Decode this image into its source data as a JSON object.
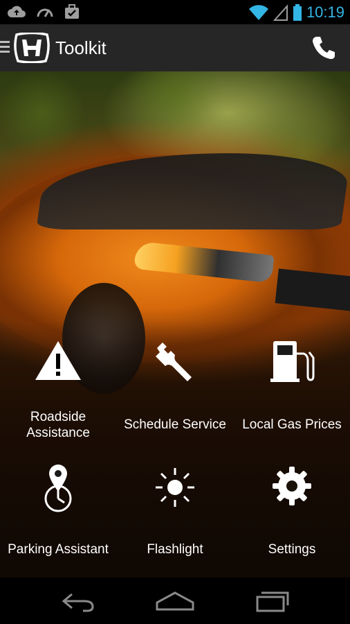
{
  "status_bar": {
    "time": "10:19",
    "left_icons": [
      "cloud-upload-icon",
      "speedometer-icon",
      "briefcase-check-icon"
    ],
    "right_icons": [
      "wifi-icon",
      "cell-signal-icon",
      "battery-icon"
    ],
    "accent_color": "#33b5e5"
  },
  "action_bar": {
    "title": "Toolkit",
    "logo": "honda-logo",
    "call_icon": "phone-icon"
  },
  "tools": [
    {
      "label": "Roadside\nAssistance",
      "icon": "warning-triangle-icon"
    },
    {
      "label": "Schedule Service",
      "icon": "wrench-icon"
    },
    {
      "label": "Local Gas Prices",
      "icon": "gas-pump-icon"
    },
    {
      "label": "Parking Assistant",
      "icon": "map-pin-clock-icon"
    },
    {
      "label": "Flashlight",
      "icon": "flashlight-sun-icon"
    },
    {
      "label": "Settings",
      "icon": "gear-icon"
    }
  ],
  "nav_bar": {
    "back": "back-icon",
    "home": "home-icon",
    "recents": "recent-apps-icon"
  }
}
